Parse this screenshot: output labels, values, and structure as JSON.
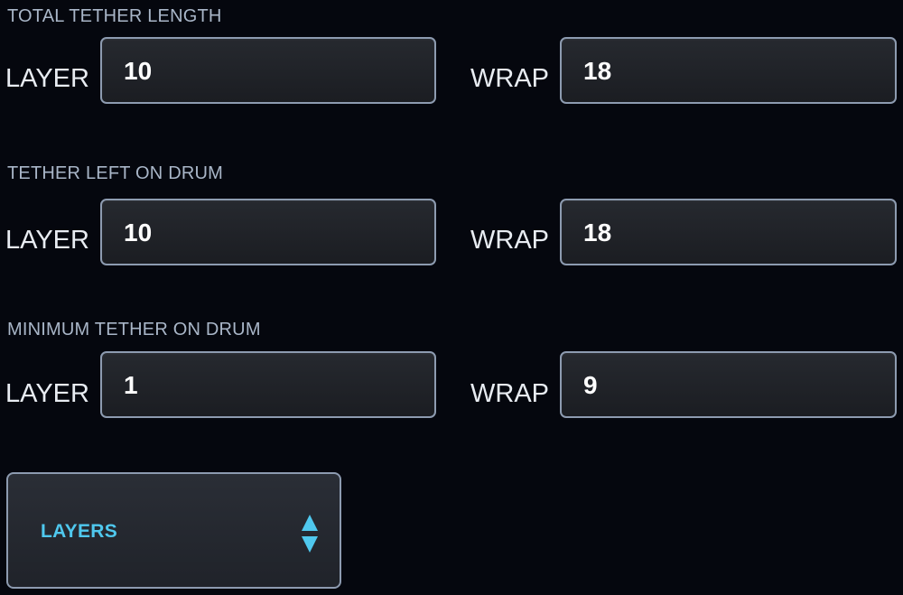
{
  "sections": [
    {
      "title": "TOTAL TETHER LENGTH",
      "layer": {
        "label": "LAYER",
        "value": "10"
      },
      "wrap": {
        "label": "WRAP",
        "value": "18"
      }
    },
    {
      "title": "TETHER LEFT ON DRUM",
      "layer": {
        "label": "LAYER",
        "value": "10"
      },
      "wrap": {
        "label": "WRAP",
        "value": "18"
      }
    },
    {
      "title": "MINIMUM TETHER ON DRUM",
      "layer": {
        "label": "LAYER",
        "value": "1"
      },
      "wrap": {
        "label": "WRAP",
        "value": "9"
      }
    }
  ],
  "unit_select": {
    "selected": "LAYERS",
    "icon": "up-down-arrows-icon",
    "accent_color": "#4fc8ee"
  }
}
